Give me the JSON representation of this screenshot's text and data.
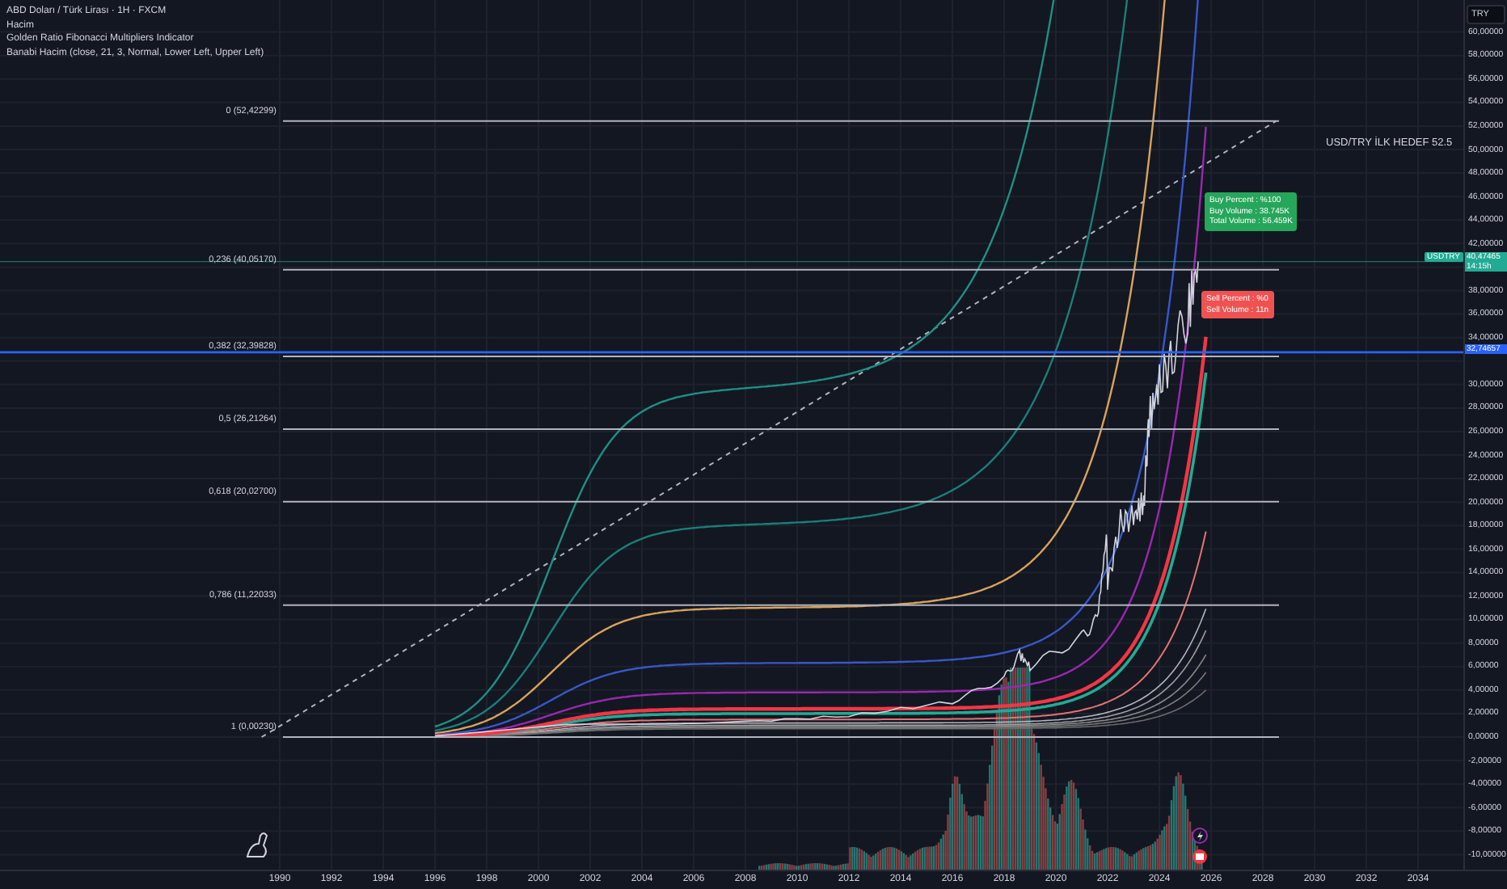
{
  "legend": [
    "ABD Doları / Türk Lirası · 1H · FXCM",
    "Hacim",
    "Golden Ratio Fibonacci Multipliers Indicator",
    "Banabi Hacim (close, 21, 3, Normal, Lower Left, Upper Left)"
  ],
  "currency_button": "TRY",
  "price_axis": [
    {
      "labels": [
        "60,00000",
        "58,00000",
        "56,00000",
        "54,00000",
        "52,00000",
        "50,00000",
        "48,00000",
        "46,00000",
        "44,00000",
        "42,00000"
      ]
    },
    {
      "labels": [
        "38,00000",
        "36,00000",
        "34,00000"
      ]
    },
    {
      "labels": [
        "30,00000",
        "28,00000",
        "26,00000",
        "24,00000",
        "22,00000",
        "20,00000",
        "18,00000",
        "16,00000",
        "14,00000",
        "12,00000",
        "10,00000",
        "8,00000",
        "6,00000",
        "4,00000",
        "2,00000",
        "0,00000",
        "-2,00000",
        "-4,00000",
        "-6,00000",
        "-8,00000",
        "-10,00000"
      ]
    }
  ],
  "time_axis": [
    "1990",
    "1992",
    "1994",
    "1996",
    "1998",
    "2000",
    "2002",
    "2004",
    "2006",
    "2008",
    "2010",
    "2012",
    "2014",
    "2016",
    "2018",
    "2020",
    "2022",
    "2024",
    "2026",
    "2028",
    "2030",
    "2032",
    "2034"
  ],
  "fib_levels": [
    {
      "label": "0 (52,42299)"
    },
    {
      "label": "0,236 (40,05170)"
    },
    {
      "label": "0,382 (32,39828)"
    },
    {
      "label": "0,5 (26,21264)"
    },
    {
      "label": "0,618 (20,02700)"
    },
    {
      "label": "0,786 (11,22033)"
    },
    {
      "label": "1 (0,00230)"
    }
  ],
  "target_label": "USD/TRY İLK HEDEF 52.5",
  "buy_box": [
    "Buy Percent : %100",
    "Buy Volume : 38.745K",
    "Total Volume : 56.459K"
  ],
  "sell_box": [
    "Sell Percent : %0",
    "Sell Volume : 11n"
  ],
  "price_badges": [
    {
      "kind": "symbol",
      "symbol": "USDTRY",
      "value": "40,47465",
      "countdown": "14:15h",
      "color": "#22ab94"
    },
    {
      "kind": "level",
      "value": "32,74657",
      "color": "#2962ff"
    }
  ]
}
